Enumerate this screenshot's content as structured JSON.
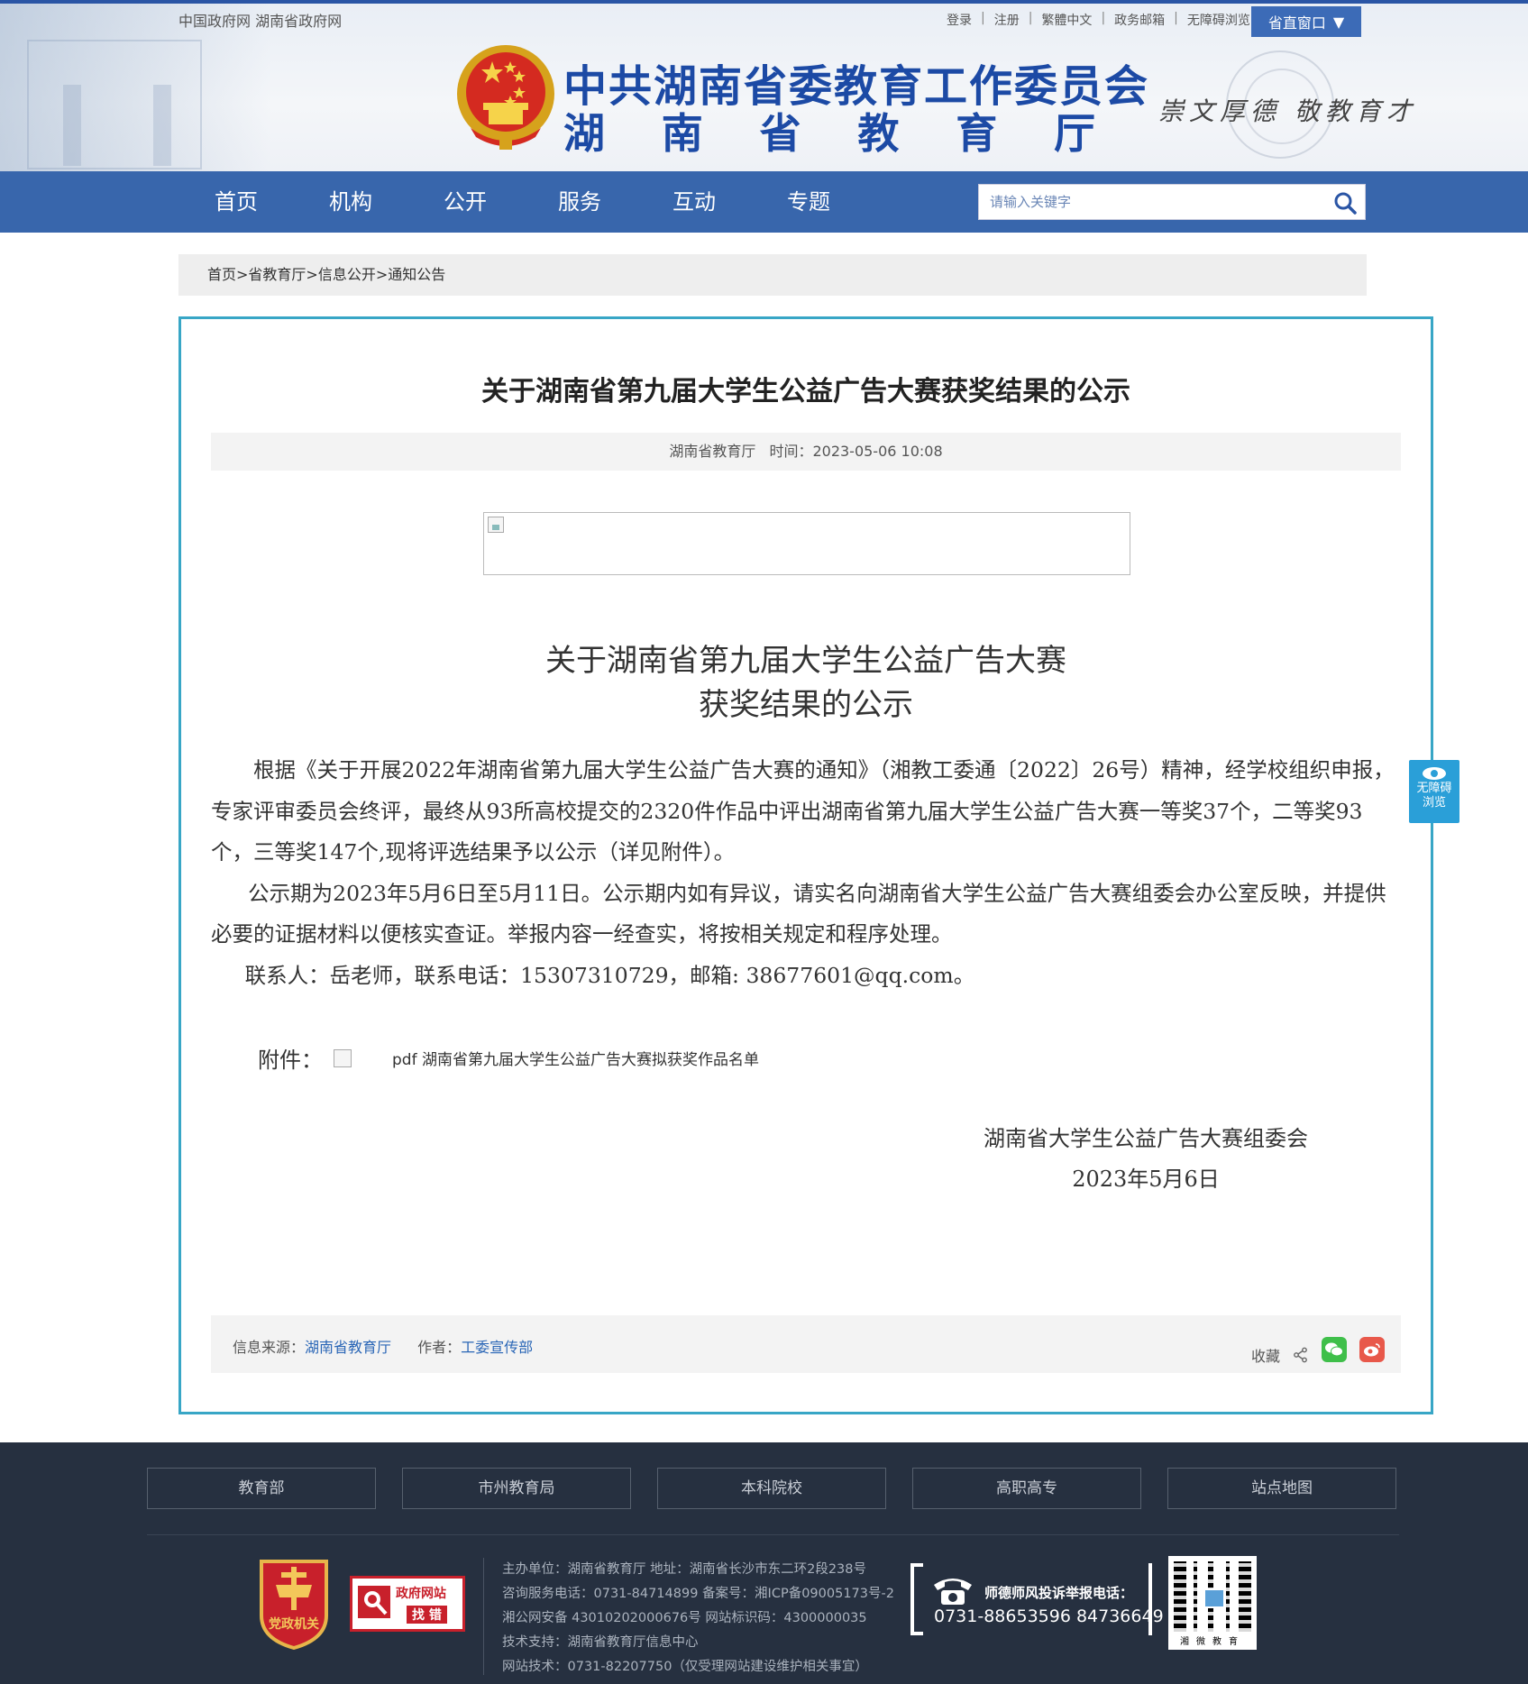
{
  "header": {
    "top_left": "中国政府网 湖南省政府网",
    "top_links": [
      "登录",
      "注册",
      "繁體中文",
      "政务邮箱",
      "无障碍浏览"
    ],
    "sheng_window": "省直窗口",
    "title_line1": "中共湖南省委教育工作委员会",
    "title_line2_chars": [
      "湖",
      "南",
      "省",
      "教",
      "育",
      "厅"
    ],
    "slogan": "崇文厚德  敬教育才"
  },
  "nav": {
    "items": [
      "首页",
      "机构",
      "公开",
      "服务",
      "互动",
      "专题"
    ],
    "search_placeholder": "请输入关键字"
  },
  "breadcrumb": "首页>省教育厅>信息公开>通知公告",
  "article": {
    "title": "关于湖南省第九届大学生公益广告大赛获奖结果的公示",
    "source": "湖南省教育厅",
    "time": "时间：2023-05-06 10:08",
    "sub_title_1": "关于湖南省第九届大学生公益广告大赛",
    "sub_title_2": "获奖结果的公示",
    "para1": "根据《关于开展2022年湖南省第九届大学生公益广告大赛的通知》（湘教工委通〔2022〕26号）精神，经学校组织申报，专家评审委员会终评，最终从93所高校提交的2320件作品中评出湖南省第九届大学生公益广告大赛一等奖37个，二等奖93个，三等奖147个,现将评选结果予以公示（详见附件）。",
    "para2": "公示期为2023年5月6日至5月11日。公示期内如有异议，请实名向湖南省大学生公益广告大赛组委会办公室反映，并提供必要的证据材料以便核实查证。举报内容一经查实，将按相关规定和程序处理。",
    "para3": "联系人：岳老师，联系电话：15307310729，邮箱: 38677601@qq.com。",
    "attach_label": "附件：",
    "attach_link": "pdf 湖南省第九届大学生公益广告大赛拟获奖作品名单",
    "sign_org": "湖南省大学生公益广告大赛组委会",
    "sign_date": "2023年5月6日",
    "info_source_label": "信息来源：",
    "info_source": "湖南省教育厅",
    "author_label": "作者：",
    "author": "工委宣传部",
    "favorite": "收藏"
  },
  "accessibility": {
    "line1": "无障碍",
    "line2": "浏览"
  },
  "footer": {
    "links": [
      "教育部",
      "市州教育局",
      "本科院校",
      "高职高专",
      "站点地图"
    ],
    "badge_text": "党政机关",
    "zhaocuo_1": "政府网站",
    "zhaocuo_2": "找 错",
    "info_lines": [
      "主办单位：湖南省教育厅  地址：湖南省长沙市东二环2段238号",
      "咨询服务电话：0731-84714899 备案号：湘ICP备09005173号-2",
      "湘公网安备 43010202000676号 网站标识码：4300000035",
      "技术支持：湖南省教育厅信息中心",
      "网站技术：0731-82207750（仅受理网站建设维护相关事宜）"
    ],
    "hotline_title": "师德师风投诉举报电话：",
    "hotline_number": "0731-88653596  84736649",
    "qr_caption": "湘微教育"
  },
  "colors": {
    "nav_blue": "#3866ac",
    "title_blue": "#1c4aa5",
    "frame_teal": "#38a6c6",
    "footer_bg": "#263040",
    "link_blue": "#2a66b6"
  }
}
